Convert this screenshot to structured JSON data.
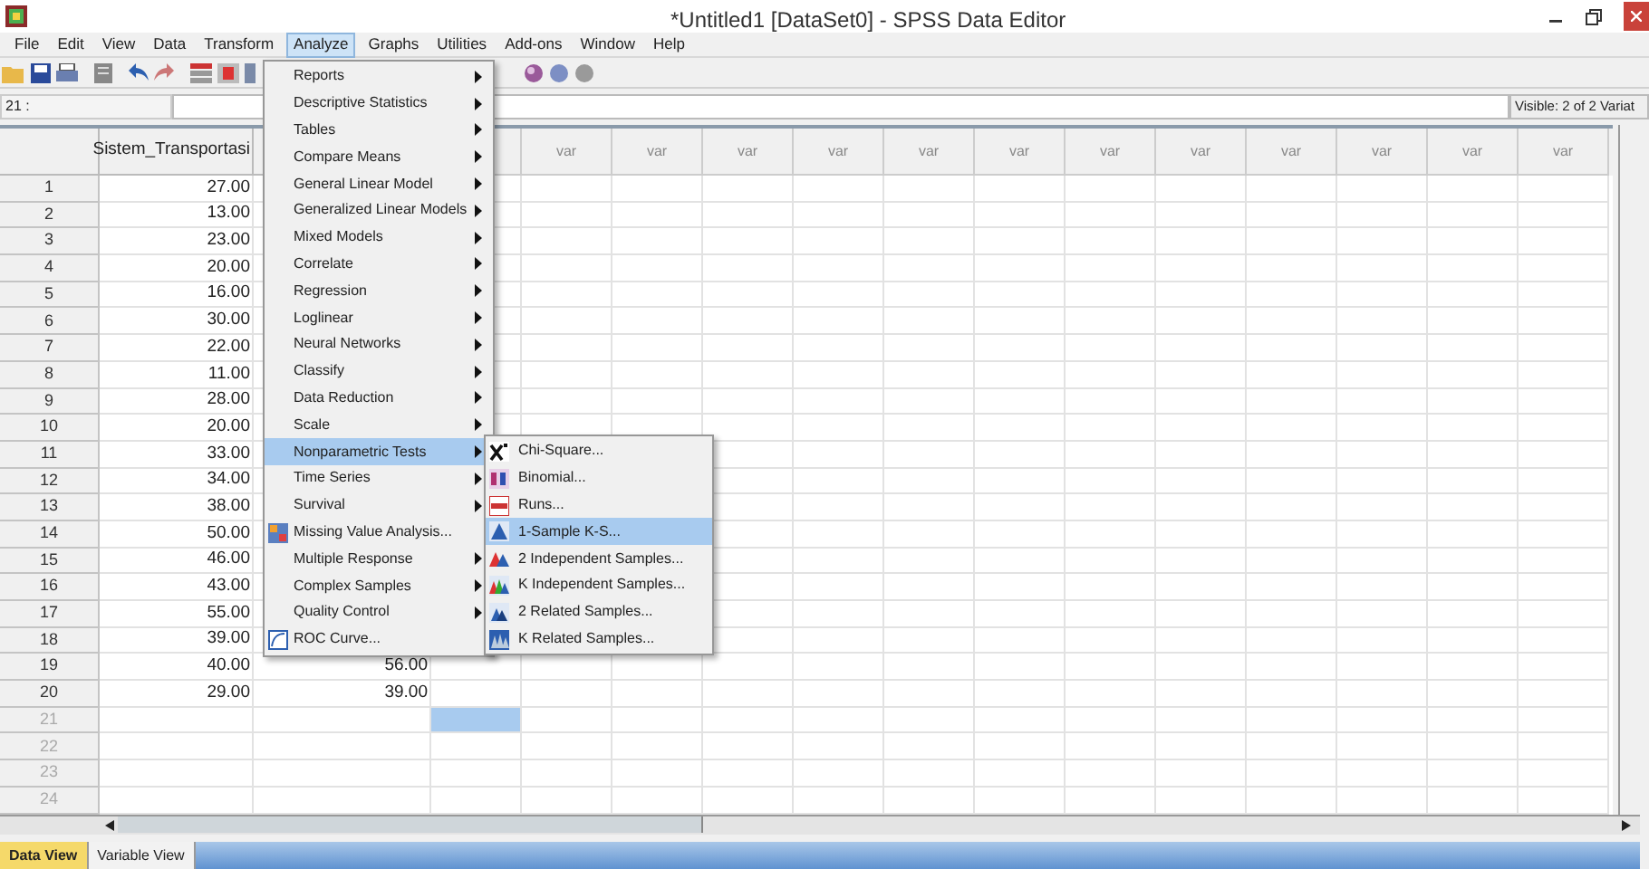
{
  "window": {
    "title": "*Untitled1 [DataSet0] - SPSS Data Editor"
  },
  "menu_bar": [
    {
      "label": "File",
      "selected": false
    },
    {
      "label": "Edit",
      "selected": false
    },
    {
      "label": "View",
      "selected": false
    },
    {
      "label": "Data",
      "selected": false
    },
    {
      "label": "Transform",
      "selected": false
    },
    {
      "label": "Analyze",
      "selected": true
    },
    {
      "label": "Graphs",
      "selected": false
    },
    {
      "label": "Utilities",
      "selected": false
    },
    {
      "label": "Add-ons",
      "selected": false
    },
    {
      "label": "Window",
      "selected": false
    },
    {
      "label": "Help",
      "selected": false
    }
  ],
  "cell_editor": {
    "cell_reference": "21 :",
    "visible_label": "Visible: 2 of 2 Variat"
  },
  "grid": {
    "columns": [
      "Sistem_Transportasi"
    ],
    "var_columns": [
      "var",
      "var",
      "var",
      "var",
      "var",
      "var",
      "var",
      "var",
      "var",
      "var",
      "var",
      "var"
    ],
    "rows": [
      {
        "number": "1",
        "cells": [
          "27.00"
        ],
        "has_data": true,
        "selected": false
      },
      {
        "number": "2",
        "cells": [
          "13.00"
        ],
        "has_data": true,
        "selected": false
      },
      {
        "number": "3",
        "cells": [
          "23.00"
        ],
        "has_data": true,
        "selected": false
      },
      {
        "number": "4",
        "cells": [
          "20.00"
        ],
        "has_data": true,
        "selected": false
      },
      {
        "number": "5",
        "cells": [
          "16.00"
        ],
        "has_data": true,
        "selected": false
      },
      {
        "number": "6",
        "cells": [
          "30.00"
        ],
        "has_data": true,
        "selected": false
      },
      {
        "number": "7",
        "cells": [
          "22.00"
        ],
        "has_data": true,
        "selected": false
      },
      {
        "number": "8",
        "cells": [
          "11.00"
        ],
        "has_data": true,
        "selected": false
      },
      {
        "number": "9",
        "cells": [
          "28.00"
        ],
        "has_data": true,
        "selected": false
      },
      {
        "number": "10",
        "cells": [
          "20.00"
        ],
        "has_data": true,
        "selected": false
      },
      {
        "number": "11",
        "cells": [
          "33.00"
        ],
        "has_data": true,
        "selected": false
      },
      {
        "number": "12",
        "cells": [
          "34.00"
        ],
        "has_data": true,
        "selected": false
      },
      {
        "number": "13",
        "cells": [
          "38.00"
        ],
        "has_data": true,
        "selected": false
      },
      {
        "number": "14",
        "cells": [
          "50.00"
        ],
        "has_data": true,
        "selected": false
      },
      {
        "number": "15",
        "cells": [
          "46.00"
        ],
        "has_data": true,
        "selected": false
      },
      {
        "number": "16",
        "cells": [
          "43.00"
        ],
        "has_data": true,
        "selected": false
      },
      {
        "number": "17",
        "cells": [
          "55.00"
        ],
        "has_data": true,
        "selected": false
      },
      {
        "number": "18",
        "cells": [
          "39.00"
        ],
        "has_data": true,
        "selected": false
      },
      {
        "number": "19",
        "cells": [
          "40.00",
          "56.00"
        ],
        "has_data": true,
        "selected": false
      },
      {
        "number": "20",
        "cells": [
          "29.00",
          "39.00"
        ],
        "has_data": true,
        "selected": false
      },
      {
        "number": "21",
        "cells": [],
        "has_data": false,
        "selected": true
      },
      {
        "number": "22",
        "cells": [],
        "has_data": false,
        "selected": false
      },
      {
        "number": "23",
        "cells": [],
        "has_data": false,
        "selected": false
      },
      {
        "number": "24",
        "cells": [],
        "has_data": false,
        "selected": false
      }
    ]
  },
  "analyze_menu": [
    {
      "label": "Reports",
      "kind": "submenu",
      "selected": false
    },
    {
      "label": "Descriptive Statistics",
      "kind": "submenu",
      "selected": false
    },
    {
      "label": "Tables",
      "kind": "submenu",
      "selected": false
    },
    {
      "label": "Compare Means",
      "kind": "submenu",
      "selected": false
    },
    {
      "label": "General Linear Model",
      "kind": "submenu",
      "selected": false
    },
    {
      "label": "Generalized Linear Models",
      "kind": "submenu",
      "selected": false
    },
    {
      "label": "Mixed Models",
      "kind": "submenu",
      "selected": false
    },
    {
      "label": "Correlate",
      "kind": "submenu",
      "selected": false
    },
    {
      "label": "Regression",
      "kind": "submenu",
      "selected": false
    },
    {
      "label": "Loglinear",
      "kind": "submenu",
      "selected": false
    },
    {
      "label": "Neural Networks",
      "kind": "submenu",
      "selected": false
    },
    {
      "label": "Classify",
      "kind": "submenu",
      "selected": false
    },
    {
      "label": "Data Reduction",
      "kind": "submenu",
      "selected": false
    },
    {
      "label": "Scale",
      "kind": "submenu",
      "selected": false
    },
    {
      "label": "Nonparametric Tests",
      "kind": "submenu",
      "selected": true
    },
    {
      "label": "Time Series",
      "kind": "submenu",
      "selected": false
    },
    {
      "label": "Survival",
      "kind": "submenu",
      "selected": false
    },
    {
      "label": "Missing Value Analysis...",
      "kind": "command",
      "selected": false
    },
    {
      "label": "Multiple Response",
      "kind": "submenu",
      "selected": false
    },
    {
      "label": "Complex Samples",
      "kind": "submenu",
      "selected": false
    },
    {
      "label": "Quality Control",
      "kind": "submenu",
      "selected": false
    },
    {
      "label": "ROC Curve...",
      "kind": "command",
      "selected": false
    }
  ],
  "nonparametric_submenu": [
    {
      "label": "Chi-Square...",
      "selected": false
    },
    {
      "label": "Binomial...",
      "selected": false
    },
    {
      "label": "Runs...",
      "selected": false
    },
    {
      "label": "1-Sample K-S...",
      "selected": true
    },
    {
      "label": "2 Independent Samples...",
      "selected": false
    },
    {
      "label": "K Independent Samples...",
      "selected": false
    },
    {
      "label": "2 Related Samples...",
      "selected": false
    },
    {
      "label": "K Related Samples...",
      "selected": false
    }
  ],
  "tabs": [
    {
      "label": "Data View",
      "selected": true
    },
    {
      "label": "Variable View",
      "selected": false
    }
  ]
}
